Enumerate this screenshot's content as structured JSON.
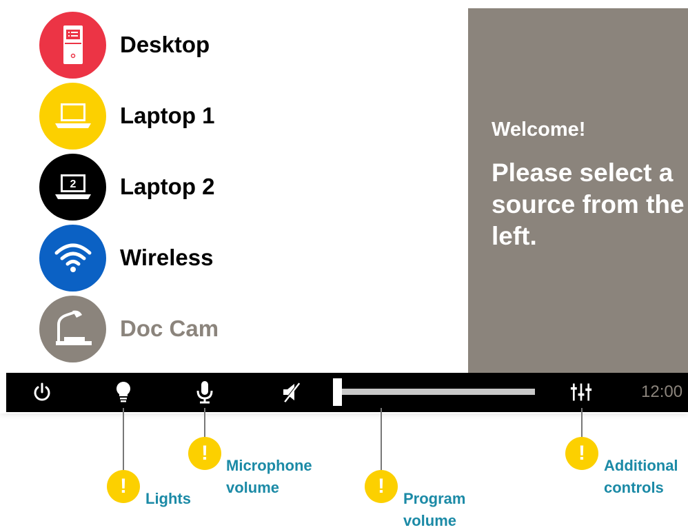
{
  "sources": [
    {
      "label": "Desktop",
      "icon": "desktop-tower-icon",
      "color": "#ec3445",
      "enabled": true
    },
    {
      "label": "Laptop 1",
      "icon": "laptop-icon",
      "color": "#fcd000",
      "enabled": true
    },
    {
      "label": "Laptop 2",
      "icon": "laptop-2-icon",
      "icon_text": "2",
      "color": "#000000",
      "enabled": true
    },
    {
      "label": "Wireless",
      "icon": "wifi-icon",
      "color": "#0b61c4",
      "enabled": true
    },
    {
      "label": "Doc Cam",
      "icon": "document-camera-icon",
      "color": "#8b847c",
      "enabled": false
    }
  ],
  "welcome": {
    "title": "Welcome!",
    "message": "Please select a source from the left."
  },
  "toolbar": {
    "icons": [
      "power-icon",
      "lightbulb-icon",
      "microphone-icon",
      "mute-icon",
      "mixer-icon"
    ],
    "program_volume_level": 0,
    "clock": "12:00"
  },
  "callouts": {
    "badge_mark": "!",
    "lights": "Lights",
    "microphone_volume": "Microphone volume",
    "program_volume": "Program volume",
    "additional_controls": "Additional controls"
  },
  "colors": {
    "accent_yellow": "#fcd000",
    "callout_text": "#1b8aa6",
    "panel_gray": "#8b847c"
  }
}
